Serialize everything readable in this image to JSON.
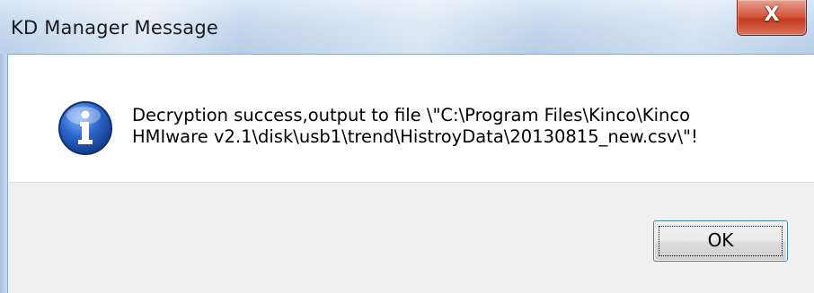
{
  "window": {
    "title": "KD Manager Message",
    "close_glyph": "X"
  },
  "dialog": {
    "icon": "information-icon",
    "message_line1": "Decryption success,output to file \\\"C:\\Program Files\\Kinco\\Kinco",
    "message_line2": "HMIware v2.1\\disk\\usb1\\trend\\HistroyData\\20130815_new.csv\\\"!"
  },
  "buttons": {
    "ok_label": "OK"
  },
  "colors": {
    "title_bar": "#c4d8ee",
    "close_button": "#c23a1f",
    "button_area": "#f0f0f0",
    "icon_blue": "#1e56b8"
  }
}
